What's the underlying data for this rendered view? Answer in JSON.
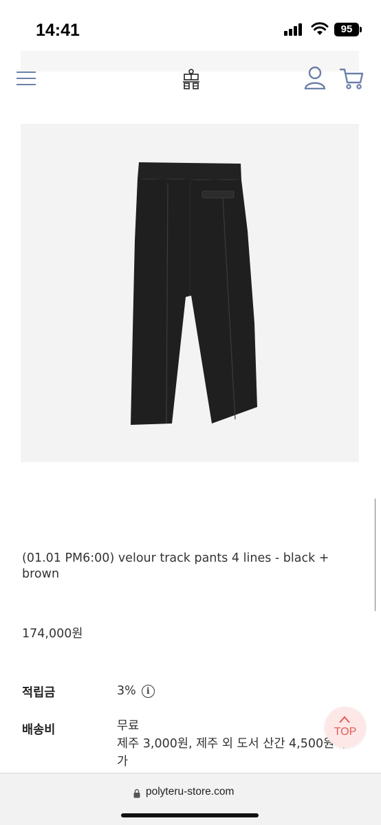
{
  "status_bar": {
    "time": "14:41",
    "battery": "95"
  },
  "header": {
    "icons": [
      "menu-icon",
      "logo",
      "user-icon",
      "cart-icon"
    ]
  },
  "product": {
    "image_desc_icon": "black-velour-track-pants",
    "title": "(01.01 PM6:00) velour track pants 4 lines - black + brown",
    "price": "174,000원"
  },
  "info": {
    "points_label": "적립금",
    "points_value": "3%",
    "shipping_label": "배송비",
    "shipping_value": "무료",
    "shipping_note": "제주 3,000원, 제주 외 도서 산간 4,500원 추가"
  },
  "top_button": {
    "label": "TOP"
  },
  "browser": {
    "url": "polyteru-store.com"
  },
  "colors": {
    "menu": "#6b7fa8",
    "top_button_bg": "#fde7e7",
    "top_button_text": "#e35a52"
  }
}
